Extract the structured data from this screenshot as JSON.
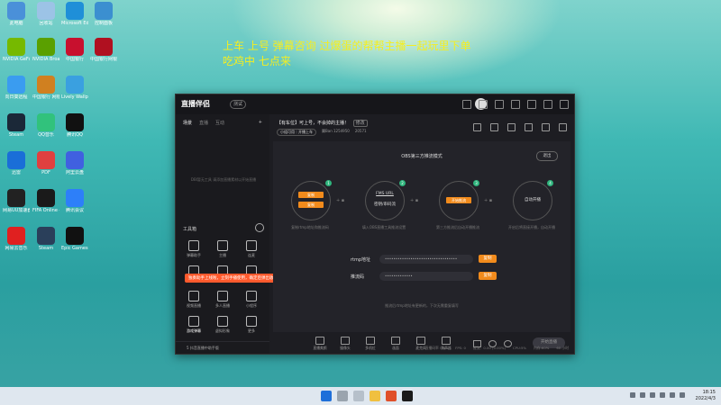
{
  "overlay": {
    "line1": "上车 上号  弹幕咨询  过爆蛋的帮帮主播一起玩里下单",
    "line2": "吃鸡中 七点来"
  },
  "desktop": {
    "icons": [
      {
        "label": "此电脑",
        "color": "#4a90d9"
      },
      {
        "label": "回收站",
        "color": "#9cc3e6"
      },
      {
        "label": "Microsoft Edge",
        "color": "#1f8fd8"
      },
      {
        "label": "控制面板",
        "color": "#3b8fd0"
      },
      {
        "label": "NVIDIA GeForce",
        "color": "#76b900"
      },
      {
        "label": "NVIDIA Broadcast",
        "color": "#5aa000"
      },
      {
        "label": "中国银行",
        "color": "#c8102e"
      },
      {
        "label": "中国银行网银",
        "color": "#b01020"
      },
      {
        "label": "向日葵远程",
        "color": "#3a9cf0"
      },
      {
        "label": "中国银行 网银助手",
        "color": "#d08020"
      },
      {
        "label": "Lively Wallpaper",
        "color": "#3aa0e0"
      },
      {
        "label": "Steam",
        "color": "#1b2838"
      },
      {
        "label": "QQ音乐",
        "color": "#31c27c"
      },
      {
        "label": "腾讯QQ",
        "color": "#111111"
      },
      {
        "label": "迅雷",
        "color": "#1a6ed8"
      },
      {
        "label": "PDF",
        "color": "#e04040"
      },
      {
        "label": "阿里云盘",
        "color": "#4060e0"
      },
      {
        "label": "网易UU加速器",
        "color": "#222222"
      },
      {
        "label": "FIFA Online 4",
        "color": "#1a1a1a"
      },
      {
        "label": "腾讯会议",
        "color": "#2d7ff9"
      },
      {
        "label": "网易云音乐",
        "color": "#e02020"
      },
      {
        "label": "Steam",
        "color": "#2a3f5a"
      },
      {
        "label": "Epic Games Launcher",
        "color": "#111111"
      }
    ]
  },
  "app": {
    "logo": "直播伴侣",
    "version": "测试",
    "left_tabs": [
      "场景",
      "直播",
      "互动"
    ],
    "left_empty": "DBI暂无工具 请添加直播素材以开始直播",
    "tools_title": "工具箱",
    "tools": [
      "弹幕助手",
      "主播",
      "连麦",
      "贡献榜",
      "PK",
      "礼物",
      "视频直播",
      "多人直播",
      "小程序",
      "游戏弹幕",
      "虚拟形象",
      "更多"
    ],
    "tooltip": "独奏助手上线啦，立刻手播使用，确定后弹出收益",
    "left_footer": "5 抖音直播中助手版",
    "room_title": "【有车位】可上号，不会掉的主播！",
    "room_edit": "修改",
    "room_tag": "小组可用｜开播上车",
    "room_views": "翼Ban  1254950",
    "room_fire": "20571",
    "panel_title": "OBS第三方推流模式",
    "exit_label": "退出",
    "steps": [
      {
        "num": "1",
        "btn1": "复制",
        "btn2": "复制"
      },
      {
        "num": "2",
        "line1": "FMS URL",
        "line2": "密钥/串码流"
      },
      {
        "num": "3",
        "btn1": "开始推流"
      },
      {
        "num": "4",
        "text": "自动开播"
      }
    ],
    "captions": [
      "复制rtmp地址和推流码",
      "填入OBS直播工具推流设置",
      "第三方推流后自动开播推流",
      "开启后将直接开播，自动开播"
    ],
    "rtmp_label": "rtmp地址",
    "rtmp_value": "••••••••••••••••••••••••••••••••••",
    "key_label": "推流码",
    "key_value": "•••••••••••••",
    "copy_label": "复制",
    "note": "推流后rtmp地址有更新的，下次无需重复填写",
    "bottom_tools": [
      "直播美颜",
      "摄像头",
      "多机位",
      "画面",
      "麦克风",
      "扬声器"
    ],
    "live_button": "开始直播",
    "status": [
      "直播码率 ON/s",
      "FPS: 0",
      "推流：0.00 (0.00%)",
      "CPU:5%",
      "内存:60%",
      "60 小时"
    ]
  },
  "taskbar": {
    "time": "18:15",
    "date": "2022/4/3"
  }
}
